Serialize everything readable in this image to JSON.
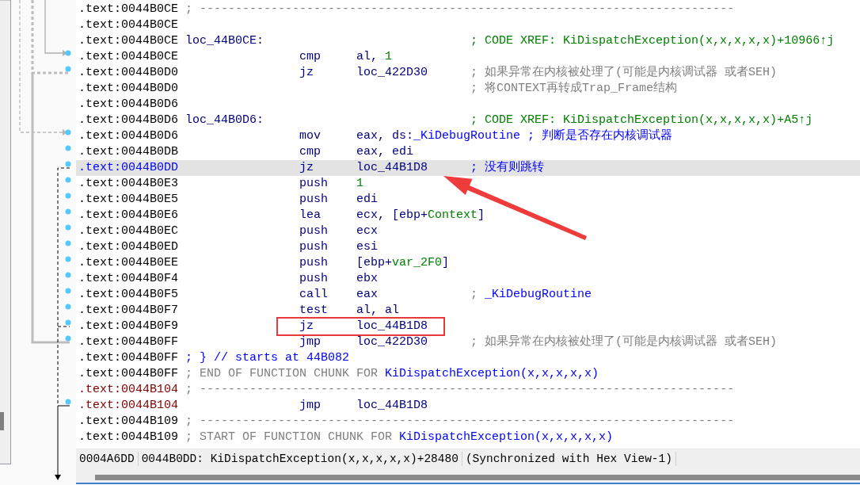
{
  "listing": {
    "rows": [
      {
        "kind": "separator",
        "address": ".text:0044B0CE",
        "color": "#000000",
        "selected": false,
        "boxed": false,
        "comment": [
          {
            "text": "; ---------------------------------------------------------------------------",
            "kind": "note"
          }
        ]
      },
      {
        "kind": "blank",
        "address": ".text:0044B0CE",
        "color": "#000000",
        "selected": false,
        "boxed": false
      },
      {
        "kind": "label",
        "address": ".text:0044B0CE",
        "color": "#000000",
        "selected": false,
        "boxed": false,
        "label": "loc_44B0CE:",
        "comment": [
          {
            "text": "; CODE XREF: KiDispatchException(x,x,x,x,x)+10966↑j",
            "kind": "xref"
          }
        ]
      },
      {
        "kind": "insn",
        "address": ".text:0044B0CE",
        "color": "#000000",
        "selected": false,
        "boxed": false,
        "mnemonic": "cmp",
        "operand": [
          {
            "text": "al, ",
            "kind": "plain"
          },
          {
            "text": "1",
            "kind": "num"
          }
        ]
      },
      {
        "kind": "insn",
        "address": ".text:0044B0D0",
        "color": "#000000",
        "selected": false,
        "boxed": false,
        "mnemonic": "jz",
        "operand": [
          {
            "text": "loc_422D30",
            "kind": "plain"
          }
        ],
        "comment": [
          {
            "text": "; 如果异常在内核被处理了(可能是内核调试器 或者SEH)",
            "kind": "note"
          }
        ]
      },
      {
        "kind": "note",
        "address": ".text:0044B0D0",
        "color": "#000000",
        "selected": false,
        "boxed": false,
        "comment": [
          {
            "text": "; 将CONTEXT再转成Trap_Frame结构",
            "kind": "note"
          }
        ]
      },
      {
        "kind": "blank",
        "address": ".text:0044B0D6",
        "color": "#000000",
        "selected": false,
        "boxed": false
      },
      {
        "kind": "label",
        "address": ".text:0044B0D6",
        "color": "#000000",
        "selected": false,
        "boxed": false,
        "label": "loc_44B0D6:",
        "comment": [
          {
            "text": "; CODE XREF: KiDispatchException(x,x,x,x,x)+A5↑j",
            "kind": "xref"
          }
        ]
      },
      {
        "kind": "insn",
        "address": ".text:0044B0D6",
        "color": "#000000",
        "selected": false,
        "boxed": false,
        "mnemonic": "mov",
        "operand": [
          {
            "text": "eax, ds:",
            "kind": "plain"
          },
          {
            "text": "_KiDebugRoutine",
            "kind": "name"
          }
        ],
        "comment": [
          {
            "text": "; 判断是否存在内核调试器",
            "kind": "user"
          }
        ]
      },
      {
        "kind": "insn",
        "address": ".text:0044B0DB",
        "color": "#000000",
        "selected": false,
        "boxed": false,
        "mnemonic": "cmp",
        "operand": [
          {
            "text": "eax, edi",
            "kind": "plain"
          }
        ]
      },
      {
        "kind": "insn",
        "address": ".text:0044B0DD",
        "color": "#0000ff",
        "selected": true,
        "boxed": false,
        "mnemonic": "jz",
        "operand": [
          {
            "text": "loc_44B1D8",
            "kind": "plain"
          }
        ],
        "comment": [
          {
            "text": "; 没有则跳转",
            "kind": "user"
          }
        ]
      },
      {
        "kind": "insn",
        "address": ".text:0044B0E3",
        "color": "#000000",
        "selected": false,
        "boxed": false,
        "mnemonic": "push",
        "operand": [
          {
            "text": "1",
            "kind": "num"
          }
        ]
      },
      {
        "kind": "insn",
        "address": ".text:0044B0E5",
        "color": "#000000",
        "selected": false,
        "boxed": false,
        "mnemonic": "push",
        "operand": [
          {
            "text": "edi",
            "kind": "plain"
          }
        ]
      },
      {
        "kind": "insn",
        "address": ".text:0044B0E6",
        "color": "#000000",
        "selected": false,
        "boxed": false,
        "mnemonic": "lea",
        "operand": [
          {
            "text": "ecx, [ebp+",
            "kind": "plain"
          },
          {
            "text": "Context",
            "kind": "var"
          },
          {
            "text": "]",
            "kind": "plain"
          }
        ]
      },
      {
        "kind": "insn",
        "address": ".text:0044B0EC",
        "color": "#000000",
        "selected": false,
        "boxed": false,
        "mnemonic": "push",
        "operand": [
          {
            "text": "ecx",
            "kind": "plain"
          }
        ]
      },
      {
        "kind": "insn",
        "address": ".text:0044B0ED",
        "color": "#000000",
        "selected": false,
        "boxed": false,
        "mnemonic": "push",
        "operand": [
          {
            "text": "esi",
            "kind": "plain"
          }
        ]
      },
      {
        "kind": "insn",
        "address": ".text:0044B0EE",
        "color": "#000000",
        "selected": false,
        "boxed": false,
        "mnemonic": "push",
        "operand": [
          {
            "text": "[ebp+",
            "kind": "plain"
          },
          {
            "text": "var_2F0",
            "kind": "var"
          },
          {
            "text": "]",
            "kind": "plain"
          }
        ]
      },
      {
        "kind": "insn",
        "address": ".text:0044B0F4",
        "color": "#000000",
        "selected": false,
        "boxed": false,
        "mnemonic": "push",
        "operand": [
          {
            "text": "ebx",
            "kind": "plain"
          }
        ]
      },
      {
        "kind": "insn",
        "address": ".text:0044B0F5",
        "color": "#000000",
        "selected": false,
        "boxed": false,
        "mnemonic": "call",
        "operand": [
          {
            "text": "eax",
            "kind": "plain"
          }
        ],
        "comment": [
          {
            "text": "; ",
            "kind": "note"
          },
          {
            "text": "_KiDebugRoutine",
            "kind": "name"
          }
        ]
      },
      {
        "kind": "insn",
        "address": ".text:0044B0F7",
        "color": "#000000",
        "selected": false,
        "boxed": false,
        "mnemonic": "test",
        "operand": [
          {
            "text": "al, al",
            "kind": "plain"
          }
        ]
      },
      {
        "kind": "insn",
        "address": ".text:0044B0F9",
        "color": "#000000",
        "selected": false,
        "boxed": true,
        "mnemonic": "jz",
        "operand": [
          {
            "text": "loc_44B1D8",
            "kind": "plain"
          }
        ]
      },
      {
        "kind": "insn",
        "address": ".text:0044B0FF",
        "color": "#000000",
        "selected": false,
        "boxed": false,
        "mnemonic": "jmp",
        "operand": [
          {
            "text": "loc_422D30",
            "kind": "plain"
          }
        ],
        "comment": [
          {
            "text": "; 如果异常在内核被处理了(可能是内核调试器 或者SEH)",
            "kind": "note"
          }
        ]
      },
      {
        "kind": "comment",
        "address": ".text:0044B0FF",
        "color": "#000000",
        "selected": false,
        "boxed": false,
        "comment": [
          {
            "text": "; } // starts at 44B082",
            "kind": "user"
          }
        ]
      },
      {
        "kind": "comment",
        "address": ".text:0044B0FF",
        "color": "#000000",
        "selected": false,
        "boxed": false,
        "comment": [
          {
            "text": "; END OF FUNCTION CHUNK FOR ",
            "kind": "note"
          },
          {
            "text": "KiDispatchException(x,x,x,x,x)",
            "kind": "name"
          }
        ]
      },
      {
        "kind": "separator",
        "address": ".text:0044B104",
        "color": "#800000",
        "selected": false,
        "boxed": false,
        "comment": [
          {
            "text": "; ---------------------------------------------------------------------------",
            "kind": "note"
          }
        ]
      },
      {
        "kind": "insn",
        "address": ".text:0044B104",
        "color": "#800000",
        "selected": false,
        "boxed": false,
        "mnemonic": "jmp",
        "operand": [
          {
            "text": "loc_44B1D8",
            "kind": "plain"
          }
        ]
      },
      {
        "kind": "separator",
        "address": ".text:0044B109",
        "color": "#000000",
        "selected": false,
        "boxed": false,
        "comment": [
          {
            "text": "; ---------------------------------------------------------------------------",
            "kind": "note"
          }
        ]
      },
      {
        "kind": "comment",
        "address": ".text:0044B109",
        "color": "#000000",
        "selected": false,
        "boxed": false,
        "comment": [
          {
            "text": "; START OF FUNCTION CHUNK FOR ",
            "kind": "note"
          },
          {
            "text": "KiDispatchException(x,x,x,x,x)",
            "kind": "name"
          }
        ]
      }
    ]
  },
  "annotation": {
    "arrow": true
  },
  "status_bar": {
    "cells": [
      "0004A6DD",
      "0044B0DD: KiDispatchException(x,x,x,x,x)+28480",
      "(Synchronized with Hex View-1)"
    ]
  }
}
